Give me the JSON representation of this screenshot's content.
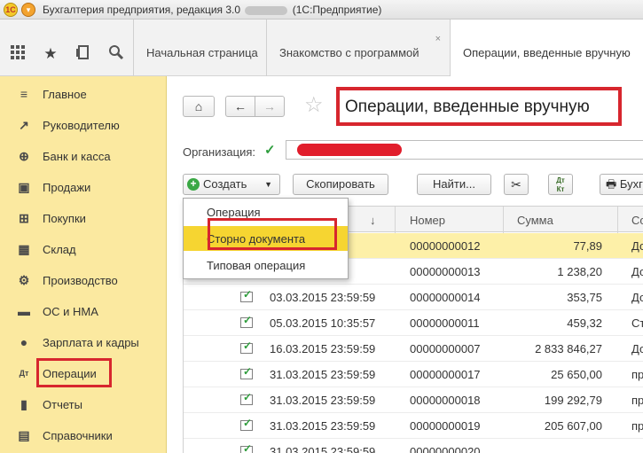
{
  "window": {
    "title_left": "Бухгалтерия предприятия, редакция 3.0",
    "title_right": "(1С:Предприятие)"
  },
  "toolbar_icons": [
    "apps-grid-icon",
    "favorites-star-icon",
    "history-icon",
    "search-icon"
  ],
  "tabs": [
    {
      "label": "Начальная страница"
    },
    {
      "label": "Знакомство с программой",
      "close": "×"
    },
    {
      "label": "Операции, введенные вручную"
    }
  ],
  "sidebar": {
    "items": [
      {
        "label": "Главное",
        "icon": "≡"
      },
      {
        "label": "Руководителю",
        "icon": "↗"
      },
      {
        "label": "Банк и касса",
        "icon": "⊕"
      },
      {
        "label": "Продажи",
        "icon": "▣"
      },
      {
        "label": "Покупки",
        "icon": "⊞"
      },
      {
        "label": "Склад",
        "icon": "▦"
      },
      {
        "label": "Производство",
        "icon": "⚙"
      },
      {
        "label": "ОС и НМА",
        "icon": "▬"
      },
      {
        "label": "Зарплата и кадры",
        "icon": "●"
      },
      {
        "label": "Операции",
        "icon": "Дт"
      },
      {
        "label": "Отчеты",
        "icon": "▮"
      },
      {
        "label": "Справочники",
        "icon": "▤"
      }
    ]
  },
  "main": {
    "home_icon": "⌂",
    "back_icon": "←",
    "forward_icon": "→",
    "star_icon": "☆",
    "page_title": "Операции, введенные вручную",
    "org_label": "Организация:",
    "org_check": "✓",
    "buttons": {
      "create": "Создать",
      "create_plus": "+",
      "create_caret": "▼",
      "copy": "Скопировать",
      "find": "Найти...",
      "clip": "✂",
      "dtkt_top": "Дт",
      "dtkt_bottom": "Кт",
      "print": "Бухг"
    },
    "dropdown": [
      {
        "label": "Операция"
      },
      {
        "label": "Сторно документа"
      },
      {
        "label": "Типовая операция"
      }
    ],
    "columns": {
      "sort": "↓",
      "number": "Номер",
      "sum": "Сумма",
      "extra": "Со"
    },
    "rows": [
      {
        "date": "",
        "number": "00000000012",
        "sum": "77,89",
        "extra": "До"
      },
      {
        "date": "",
        "number": "00000000013",
        "sum": "1 238,20",
        "extra": "До"
      },
      {
        "date": "03.03.2015 23:59:59",
        "number": "00000000014",
        "sum": "353,75",
        "extra": "До"
      },
      {
        "date": "05.03.2015 10:35:57",
        "number": "00000000011",
        "sum": "459,32",
        "extra": "Ст"
      },
      {
        "date": "16.03.2015 23:59:59",
        "number": "00000000007",
        "sum": "2 833 846,27",
        "extra": "До"
      },
      {
        "date": "31.03.2015 23:59:59",
        "number": "00000000017",
        "sum": "25 650,00",
        "extra": "пр"
      },
      {
        "date": "31.03.2015 23:59:59",
        "number": "00000000018",
        "sum": "199 292,79",
        "extra": "пр"
      },
      {
        "date": "31.03.2015 23:59:59",
        "number": "00000000019",
        "sum": "205 607,00",
        "extra": "пр"
      },
      {
        "date": "31.03.2015 23:59:59",
        "number": "00000000020",
        "sum": "",
        "extra": ""
      }
    ]
  }
}
